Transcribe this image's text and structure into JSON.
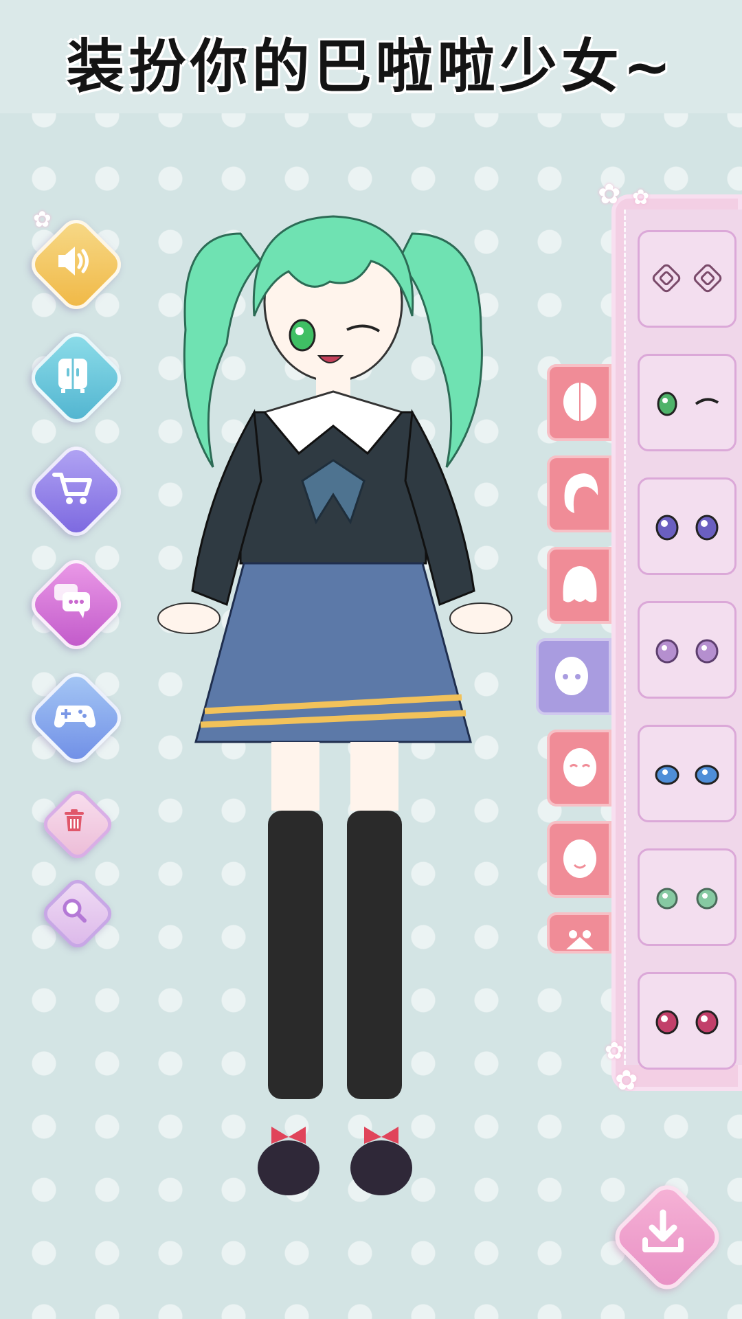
{
  "header": {
    "title": "装扮你的巴啦啦少女~"
  },
  "left_buttons": [
    {
      "name": "sound",
      "icon": "speaker-icon",
      "color": "#f2c25a"
    },
    {
      "name": "wardrobe",
      "icon": "wardrobe-icon",
      "color": "#67c7d9"
    },
    {
      "name": "shop",
      "icon": "cart-icon",
      "color": "#8f7de6"
    },
    {
      "name": "chat",
      "icon": "chat-bubbles-icon",
      "color": "#d77ad8"
    },
    {
      "name": "games",
      "icon": "gamepad-icon",
      "color": "#7ca7ea"
    },
    {
      "name": "delete",
      "icon": "trash-icon",
      "color": "#f3c8e2"
    },
    {
      "name": "zoom",
      "icon": "magnifier-icon",
      "color": "#e8c6ef"
    }
  ],
  "category_tabs": [
    {
      "name": "face-base",
      "icon": "face-half-icon",
      "active": false
    },
    {
      "name": "front-hair",
      "icon": "hair-icon",
      "active": false
    },
    {
      "name": "back-hair",
      "icon": "back-hair-icon",
      "active": false
    },
    {
      "name": "eyes",
      "icon": "face-eyes-icon",
      "active": true
    },
    {
      "name": "eyebrows",
      "icon": "face-closed-eyes-icon",
      "active": false
    },
    {
      "name": "mouth",
      "icon": "face-smile-icon",
      "active": false
    },
    {
      "name": "accessory",
      "icon": "bow-icon",
      "active": false
    }
  ],
  "eye_options": [
    {
      "style": "spiral",
      "color": "#7a4a6a"
    },
    {
      "style": "wink-green",
      "color": "#4fb36a"
    },
    {
      "style": "round-purple",
      "color": "#6a5fc0"
    },
    {
      "style": "lilac",
      "color": "#b58fcf"
    },
    {
      "style": "blue",
      "color": "#4f8ed8"
    },
    {
      "style": "mint",
      "color": "#86c9a2"
    },
    {
      "style": "pink-sparkle",
      "color": "#c2406a"
    }
  ],
  "selected_eye": "wink-green",
  "download": {
    "icon": "download-icon"
  },
  "character": {
    "hair_color": "#6fe2b2",
    "top_color": "#2f3a42",
    "skirt_color": "#5c79a8",
    "stripe_color": "#f2c25a",
    "sock_color": "#2a2a2a"
  }
}
